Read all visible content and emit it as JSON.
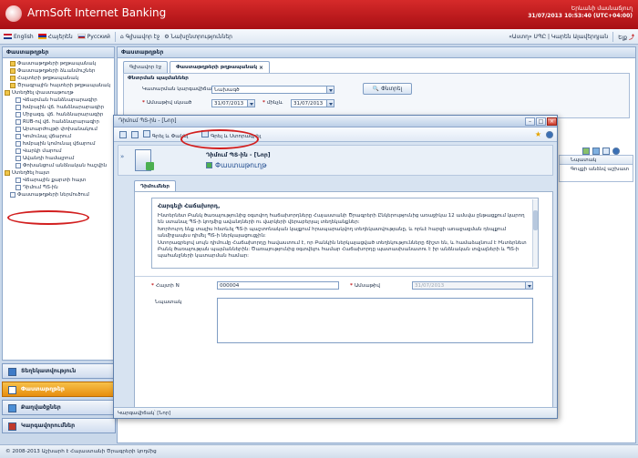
{
  "app": {
    "title": "ArmSoft Internet Banking",
    "user": "Երևանի մասնաճյուղ",
    "datetime": "31/07/2013 10:53:40 (UTC+04:00)"
  },
  "langbar": {
    "english": "English",
    "armenian": "Հայերեն",
    "russian": "Русский",
    "start_page": "Գլխավոր էջ",
    "settings": "Նախընտրություններ",
    "user_info": "«Աստղ» ՍՊԸ | Կարեն Ալավերդյան",
    "exit": "Ելք"
  },
  "sidebar": {
    "header": "Փաստաթղթեր",
    "tree": [
      {
        "label": "Փաստաթղթերի թղթապանակ",
        "icon": "folder",
        "indent": 1
      },
      {
        "label": "Փաստաթղթերի ձևանմուշներ",
        "icon": "folder",
        "indent": 1
      },
      {
        "label": "Հայտերի թղթապանակ",
        "icon": "folder",
        "indent": 1
      },
      {
        "label": "Ծրագրային հայտերի թղթապանակ",
        "icon": "folder",
        "indent": 1
      },
      {
        "label": "Ստեղծել փաստաթուղթ",
        "icon": "folder",
        "indent": 0
      },
      {
        "label": "Վճարման հանձնարարագիր",
        "icon": "doc",
        "indent": 2
      },
      {
        "label": "Խմբային վճ. հանձնարարագիր",
        "icon": "doc",
        "indent": 2
      },
      {
        "label": "Միջազգ. վճ. հանձնարարագիր",
        "icon": "doc",
        "indent": 2
      },
      {
        "label": "RUB-ով վճ. հանձնարարագիր",
        "icon": "doc",
        "indent": 2
      },
      {
        "label": "Արտարժույթի փոխանակում",
        "icon": "doc",
        "indent": 2
      },
      {
        "label": "Կոմունալ վճարում",
        "icon": "doc",
        "indent": 2
      },
      {
        "label": "Խմբային կոմունալ վճարում",
        "icon": "doc",
        "indent": 2
      },
      {
        "label": "Վարկի մարում",
        "icon": "doc",
        "indent": 2
      },
      {
        "label": "Ավանդի համալրում",
        "icon": "doc",
        "indent": 2
      },
      {
        "label": "Փոխանցում անձնական հաշվին",
        "icon": "doc",
        "indent": 2
      },
      {
        "label": "Ստեղծել հայտ",
        "icon": "folder",
        "indent": 0
      },
      {
        "label": "Վճարային քարտի հայտ",
        "icon": "doc",
        "indent": 2
      },
      {
        "label": "Դիմում ՊՏ-ին",
        "icon": "doc",
        "indent": 2
      },
      {
        "label": "Փաստաթղթերի ներմուծում",
        "icon": "doc",
        "indent": 1
      }
    ],
    "nav": [
      {
        "label": "Տեղեկատվություն"
      },
      {
        "label": "Փաստաթղթեր"
      },
      {
        "label": "Քաղվածքներ"
      },
      {
        "label": "Կարգավորումներ"
      }
    ]
  },
  "main": {
    "tabs": [
      {
        "label": "Գլխավոր էջ"
      },
      {
        "label": "Փաստաթղթերի թղթապանակ"
      }
    ],
    "filter": {
      "title": "Փնտրման պայմաններ",
      "state_label": "Կատարման կարգավիճակ",
      "state_value": "Նախագծ",
      "date_from_label": "Ամսաթիվ սկսած",
      "date_from": "31/07/2013",
      "date_to_label": "մինչև",
      "date_to": "31/07/2013",
      "search_button": "Փնտրել"
    },
    "grid_cols": [
      "Նպատակ"
    ],
    "grid_rows": [
      "Գույքի անձնվ աշխատ"
    ]
  },
  "dialog": {
    "title": "Դիմում ՊՏ-ին - [Նոր]",
    "toolbar": {
      "save_close": "Գրել և Փակել",
      "save_print": "Գրել և Ստորագրել"
    },
    "doc_title": "Դիմում ՊՏ-ին - [Նոր]",
    "doc_subtitle": "Փաստաթուղթ",
    "tab": "Դիմումներ",
    "body": {
      "greeting": "Հարգելի Հաճախորդ,",
      "p1": "Ինտերնետ Բանկ ծառայությունից օգտվող հաճախորդները Հայաստանի Ծրագրերի Ընկերությունից առաջիկա 12 ամսվա ընթացքում կարող են ստանալ ՊՏ-ի կողմից ավանդների ու վարկերի վերաբերյալ տեղեկանքներ:",
      "p2": "Խորհուրդ ենք տալիս հետևել ՊՏ-ի պաշտոնական կայքում հրապարակվող տեղեկատվությանը, և որևէ հարցի առաջացման դեպքում անմիջապես դիմել ՊՏ-ի ներկայացուցչին:",
      "p3": "Ստորագրելով սույն դիմումը Հաճախորդը հավաստում է, որ Բանկին ներկայացված տեղեկությունները ճիշտ են, և համաձայնում է Ինտերնետ Բանկ ծառայության պայմաններին: Ծառայությունից օգտվելու համար Հաճախորդը պատասխանատու է իր անձնական տվյալների և ՊՏ-ի պահանջների կատարման համար:"
    },
    "form": {
      "number_label": "Հայտի N",
      "number_value": "000004",
      "date_label": "Ամսաթիվ",
      "date_value": "31/07/2013",
      "purpose_label": "Նպատակ"
    },
    "status": "Կարգավիճակ՝ [Նոր]"
  },
  "footer": {
    "copyright": "© 2008-2013 Աշխարհ է Հայաստանի Ծրագրերի կողմից"
  },
  "colors": {
    "brand_red": "#c21d1f",
    "accent_orange": "#f0a020",
    "link_blue": "#1f4b8f"
  }
}
